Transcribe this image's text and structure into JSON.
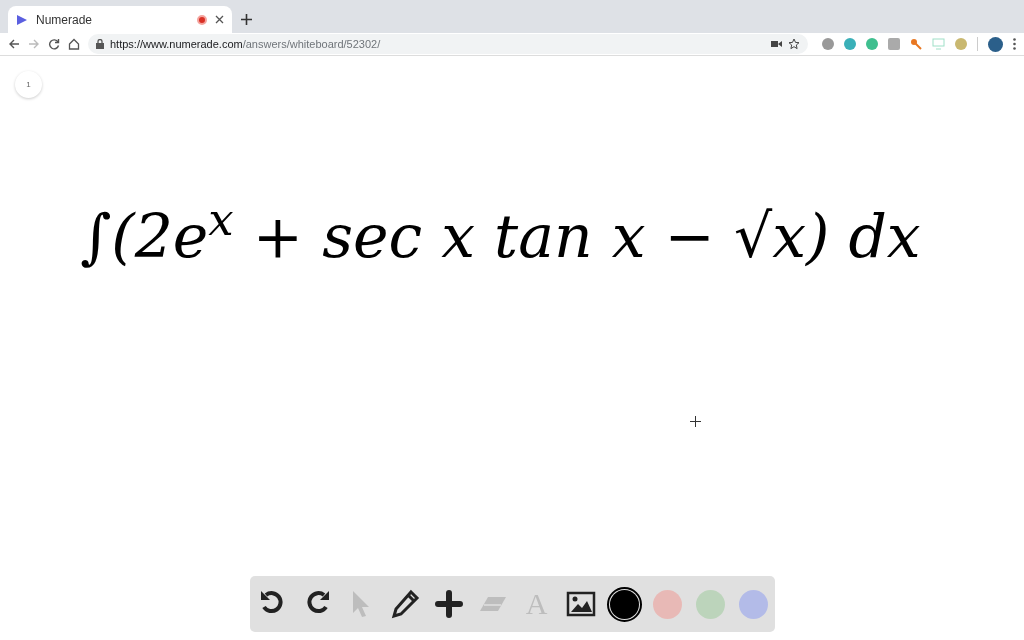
{
  "browser": {
    "tab": {
      "title": "Numerade",
      "recording": true
    },
    "url": {
      "origin": "https://www.numerade.com",
      "path": "/answers/whiteboard/52302/"
    }
  },
  "whiteboard": {
    "page_number": "1",
    "expression": "∫(2e$^{x}$ + sec x tan x − √x) dx"
  },
  "toolbar": {
    "tools": [
      {
        "kind": "undo",
        "disabled": false
      },
      {
        "kind": "redo",
        "disabled": false
      },
      {
        "kind": "pointer",
        "disabled": true
      },
      {
        "kind": "pen",
        "disabled": false
      },
      {
        "kind": "plus",
        "disabled": false
      },
      {
        "kind": "eraser",
        "disabled": true
      },
      {
        "kind": "text",
        "label": "A",
        "disabled": true
      },
      {
        "kind": "image",
        "disabled": false
      }
    ],
    "colors": [
      {
        "color": "#000000",
        "selected": true
      },
      {
        "color": "#e8b9b6",
        "selected": false
      },
      {
        "color": "#bcd4bb",
        "selected": false
      },
      {
        "color": "#b3bbe8",
        "selected": false
      }
    ]
  }
}
